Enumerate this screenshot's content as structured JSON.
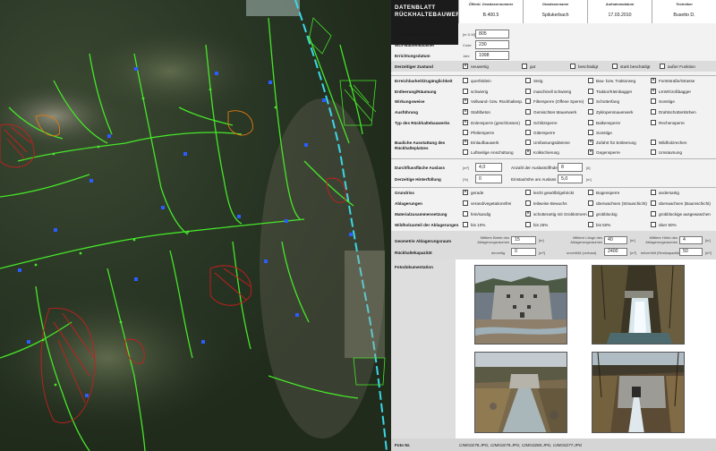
{
  "header": {
    "title_line1": "DATENBLATT",
    "title_line2": "RÜCKHALTEBAUWERK",
    "columns": [
      {
        "label": "Öffentl. Gewässernummer",
        "value": "B.400.5"
      },
      {
        "label": "Gewässername",
        "value": "Spilukerbach"
      },
      {
        "label": "Aufnahmedatum",
        "value": "17.03.2010"
      },
      {
        "label": "Techniker",
        "value": "Busetto D."
      }
    ]
  },
  "basic": {
    "hoehenlage_label": "Höhenlage des Bauwerks",
    "hoehenlage_unit": "[m Ü.M]",
    "hoehenlage_value": "805",
    "wlv_label": "WLV-Bautenkataster",
    "wlv_unit": "Code",
    "wlv_value": "230",
    "jahr_label": "Errichtungsdatum",
    "jahr_unit": "Jahr",
    "jahr_value": "1998"
  },
  "zustand": {
    "label": "Derzeitiger Zustand",
    "options": [
      {
        "text": "neuwertig",
        "checked": true
      },
      {
        "text": "gut",
        "checked": false
      },
      {
        "text": "beschädigt",
        "checked": false
      },
      {
        "text": "stark beschädigt",
        "checked": false
      },
      {
        "text": "außer Funktion",
        "checked": false
      }
    ]
  },
  "rows": [
    {
      "label": "Erreichbarkeit/Zugänglichkeit",
      "options": [
        {
          "text": "querfeldein",
          "checked": false
        },
        {
          "text": "Steig",
          "checked": false
        },
        {
          "text": "Bau- bzw. Traktorweg",
          "checked": false
        },
        {
          "text": "Forststraße/Strasse",
          "checked": true
        }
      ]
    },
    {
      "label": "Entleerung/Räumung",
      "options": [
        {
          "text": "schwierig",
          "checked": false
        },
        {
          "text": "maschinell schwierig",
          "checked": false
        },
        {
          "text": "Traktor/Kleinbagger",
          "checked": false
        },
        {
          "text": "LKW/Großbagger",
          "checked": true
        }
      ]
    },
    {
      "label": "Wirkungsweise",
      "options": [
        {
          "text": "Vollwand- bzw. Rückhaltesp.",
          "checked": true
        },
        {
          "text": "Filtersperre (Offene Sperre)",
          "checked": false
        },
        {
          "text": "Schotterfang",
          "checked": false
        },
        {
          "text": "Sonstige",
          "checked": false
        }
      ]
    },
    {
      "label": "Ausführung",
      "options": [
        {
          "text": "Stahlbeton",
          "checked": true
        },
        {
          "text": "Gemischtes Mauerwerk",
          "checked": false
        },
        {
          "text": "Zyklopenmauerwerk",
          "checked": false
        },
        {
          "text": "Drahtschotterkörben",
          "checked": false
        }
      ]
    },
    {
      "label": "Typ des Rückhaltebauwerks",
      "options": [
        {
          "text": "Dolensperre (geschlossen)",
          "checked": true
        },
        {
          "text": "Schlitzsperre",
          "checked": false
        },
        {
          "text": "Balkensperre",
          "checked": false
        },
        {
          "text": "Rechensperre",
          "checked": false
        },
        {
          "text": "Pfeilersperre",
          "checked": false
        },
        {
          "text": "Gittersperre",
          "checked": false
        },
        {
          "text": "Sonstige",
          "checked": false
        }
      ]
    },
    {
      "label": "Bauliche Ausstattung des Rückhalteplatzes",
      "options": [
        {
          "text": "Einlaufbauwerk",
          "checked": true
        },
        {
          "text": "Umfassungsdämme",
          "checked": false
        },
        {
          "text": "Zufahrt für Entleerung",
          "checked": true
        },
        {
          "text": "Wildholzrechen",
          "checked": false
        },
        {
          "text": "Luftseitige Anschüttung",
          "checked": false
        },
        {
          "text": "Kolkschierung",
          "checked": true
        },
        {
          "text": "Gegensperre",
          "checked": true
        },
        {
          "text": "Umsäumung",
          "checked": false
        }
      ]
    }
  ],
  "durchfluss": {
    "label": "Durchflussfläche Auslass",
    "unit": "[m²]",
    "value": "4,0",
    "anzahl_label": "Anzahl der Auslassöffnder",
    "anzahl_unit": "[#]",
    "anzahl_value": "8"
  },
  "hinterfuellung": {
    "label": "Derzeitige Hinterfüllung",
    "unit": "[%]",
    "value": "0",
    "einstau_label": "Einstauhöhe am Auslass",
    "einstau_unit": "[m]",
    "einstau_value": "5,0"
  },
  "lower_rows": [
    {
      "label": "Grundriss",
      "options": [
        {
          "text": "gerade",
          "checked": true
        },
        {
          "text": "leicht gewölbt/gebrickt",
          "checked": false
        },
        {
          "text": "Bogensperre",
          "checked": false
        },
        {
          "text": "andersartig",
          "checked": false
        }
      ]
    },
    {
      "label": "Ablagerungen",
      "options": [
        {
          "text": "verand/vegetationsfrei",
          "checked": false
        },
        {
          "text": "teilweise Bewuchs",
          "checked": false
        },
        {
          "text": "überwachsen (Strauschicht)",
          "checked": false
        },
        {
          "text": "überwachsen (Baumschicht)",
          "checked": false
        }
      ]
    },
    {
      "label": "Materialzusammensetzung",
      "options": [
        {
          "text": "fein/sandig",
          "checked": false
        },
        {
          "text": "schotterartig mit Grobkörnern",
          "checked": true
        },
        {
          "text": "grobblockig",
          "checked": false
        },
        {
          "text": "grobblockige ausgewaschen",
          "checked": false
        }
      ]
    },
    {
      "label": "Wildholzanteil der Ablagerungen",
      "options": [
        {
          "text": "bis 10%",
          "checked": false
        },
        {
          "text": "bis 25%",
          "checked": false
        },
        {
          "text": "bis 50%",
          "checked": false
        },
        {
          "text": "über 50%",
          "checked": false
        }
      ]
    }
  ],
  "geometry": {
    "label1": "Geometrie Ablagerungsraum",
    "label2": "Rückhaltekapazität",
    "breite_label": "Mittlere Breite des Ablagerungsraumes",
    "breite_value": "15",
    "breite_unit": "[m]",
    "laenge_label": "Mittlere Länge des Ablagerungsraumes",
    "laenge_value": "40",
    "laenge_unit": "[m]",
    "hoehe_label": "Mittlere Höhe des Ablagerungsraumes",
    "hoehe_value": "4",
    "hoehe_unit": "[m]",
    "derzeitig_label": "derzeitig",
    "derzeitig_value": "0",
    "derzeitig_unit": "[m³]",
    "unverfuellt_label": "unverfüllt (verbaut)",
    "unverfuellt_value": "2400",
    "unverfuellt_unit": "[m³]",
    "verfuellt_label": "teilverfüllt (Restkapazität)",
    "verfuellt_value": "50",
    "verfuellt_unit": "[m³]"
  },
  "photos": {
    "label": "Fotodokumentation",
    "footer_label": "Foto Nr.",
    "footer_value": "CIMG0278.JPG, CIMG0279.JPG, CIMG0280.JPG, CIMG0277.JPG"
  },
  "map_colors": {
    "stream": "#46e62a",
    "structure_blue": "#2a5cff",
    "structure_red": "#c81e1e",
    "structure_orange": "#e07b10",
    "river": "#3ad8e8"
  }
}
